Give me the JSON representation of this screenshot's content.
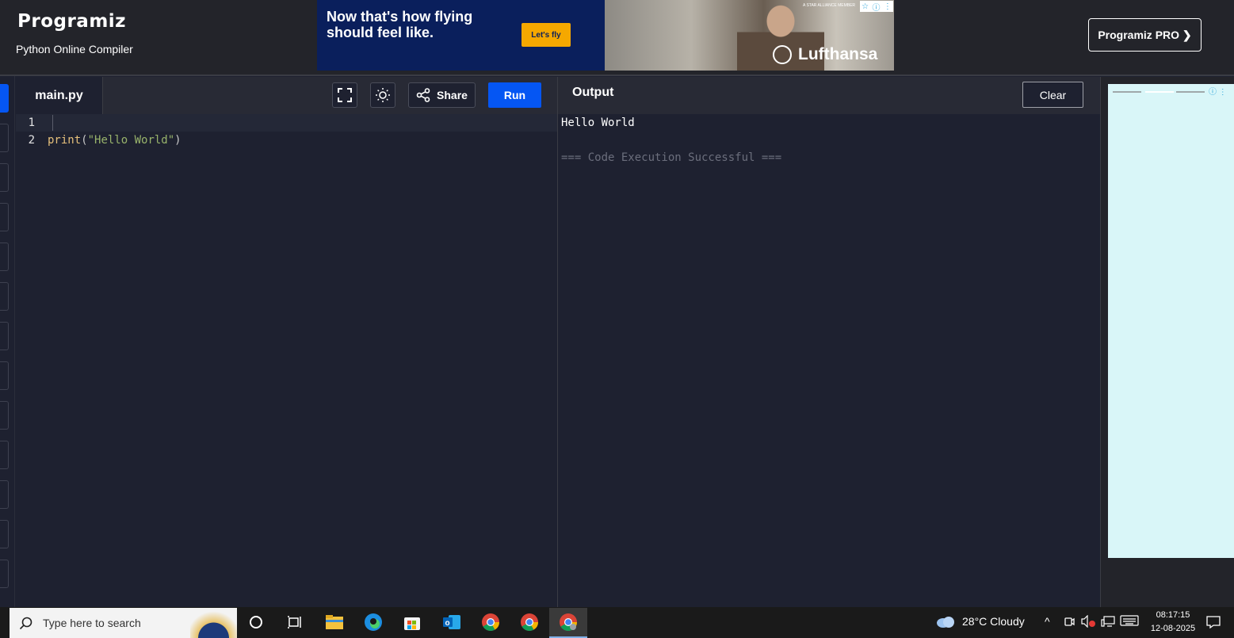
{
  "header": {
    "logo": "Programiz",
    "subtitle": "Python Online Compiler",
    "pro_button": "Programiz PRO ❯"
  },
  "ad": {
    "headline": "Now that's how flying should feel like.",
    "cta": "Let's fly",
    "brand": "Lufthansa",
    "member_text": "A STAR ALLIANCE MEMBER"
  },
  "editor": {
    "tab": "main.py",
    "share_label": "Share",
    "run_label": "Run",
    "lines": [
      {
        "num": "1",
        "code": ""
      },
      {
        "num": "2",
        "fn": "print",
        "open": "(",
        "str": "\"Hello World\"",
        "close": ")"
      }
    ]
  },
  "output": {
    "title": "Output",
    "clear_label": "Clear",
    "lines": [
      "Hello World",
      "",
      "=== Code Execution Successful ==="
    ]
  },
  "taskbar": {
    "search_placeholder": "Type here to search",
    "weather": "28°C  Cloudy",
    "time": "08:17:15",
    "date": "12-08-2025"
  },
  "colors": {
    "run": "#0556f3",
    "background": "#1e2130",
    "header": "#23242a"
  }
}
